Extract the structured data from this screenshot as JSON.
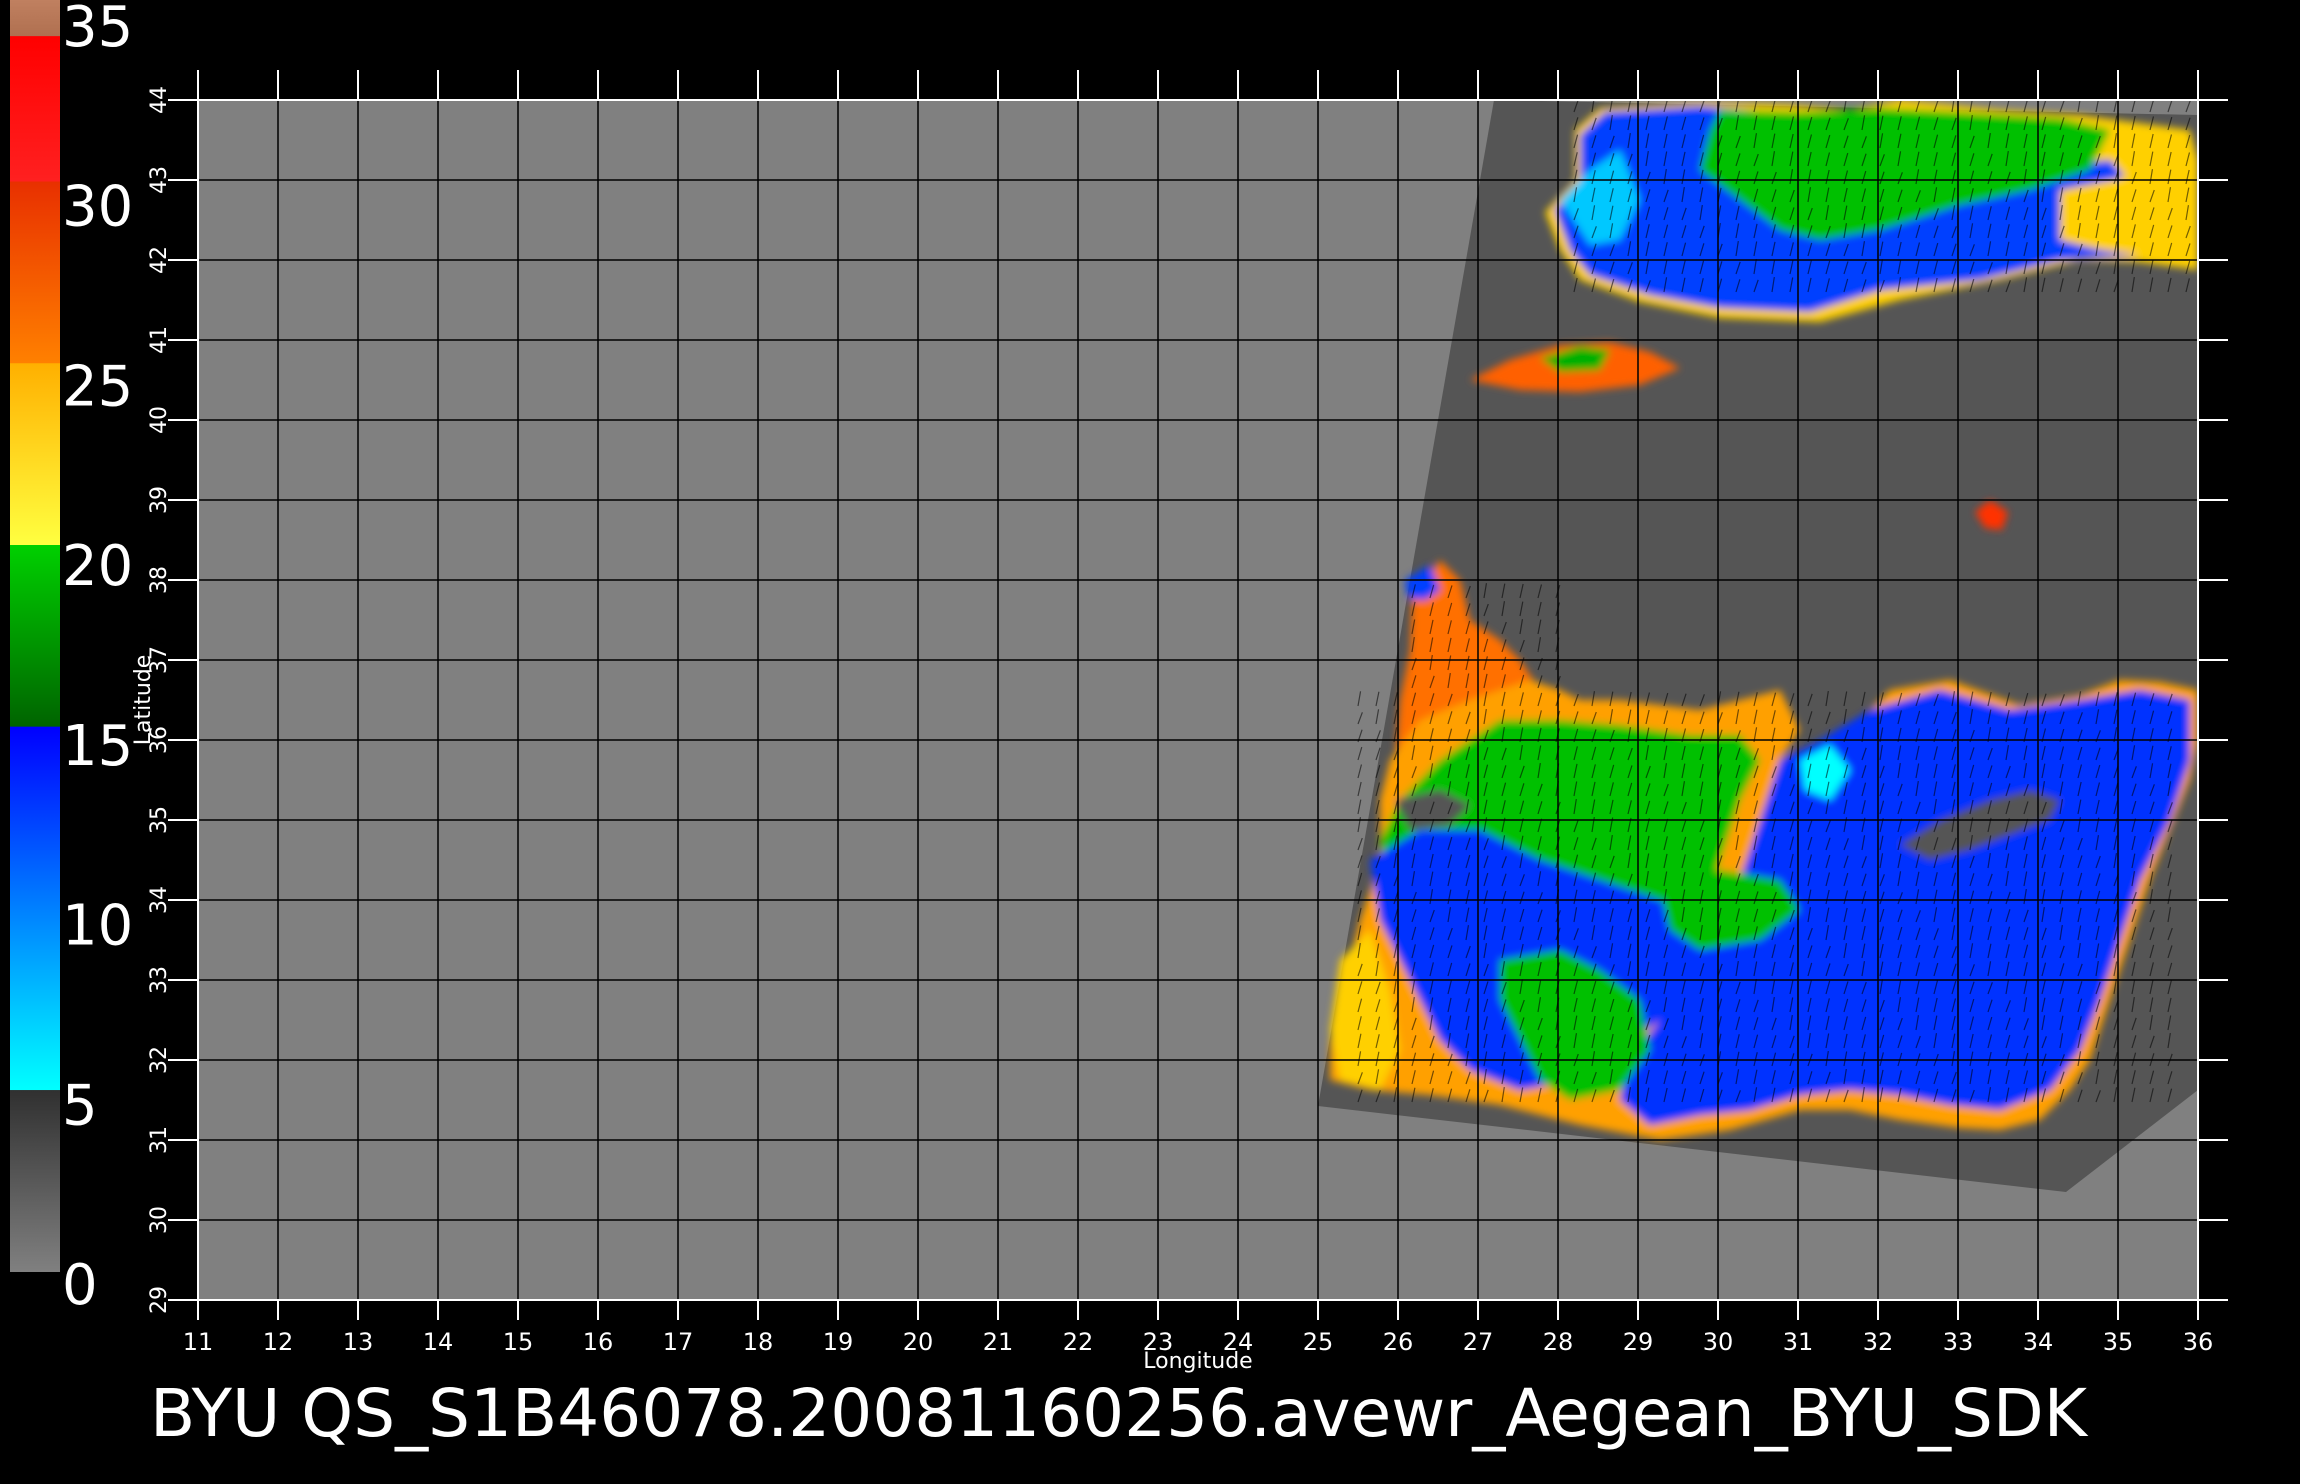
{
  "colorbar": {
    "labels": [
      "35",
      "30",
      "25",
      "20",
      "15",
      "10",
      "5",
      "0"
    ],
    "stops": [
      {
        "value": 0,
        "color": "#808080"
      },
      {
        "value": 5,
        "color": "#303030"
      },
      {
        "value": 5.01,
        "color": "#00ffff"
      },
      {
        "value": 10,
        "color": "#0080ff"
      },
      {
        "value": 15,
        "color": "#0000ff"
      },
      {
        "value": 15.01,
        "color": "#006400"
      },
      {
        "value": 20,
        "color": "#00d000"
      },
      {
        "value": 20.01,
        "color": "#ffff40"
      },
      {
        "value": 25,
        "color": "#ffb000"
      },
      {
        "value": 25.01,
        "color": "#ff8000"
      },
      {
        "value": 30,
        "color": "#e83000"
      },
      {
        "value": 30.01,
        "color": "#ff2020"
      },
      {
        "value": 34,
        "color": "#ff0000"
      },
      {
        "value": 34.01,
        "color": "#b07050"
      },
      {
        "value": 35,
        "color": "#c08060"
      }
    ],
    "range": [
      0,
      35
    ]
  },
  "map": {
    "lon_range": [
      11,
      36
    ],
    "lat_range": [
      29,
      44
    ],
    "lon_ticks": [
      "11",
      "12",
      "13",
      "14",
      "15",
      "16",
      "17",
      "18",
      "19",
      "20",
      "21",
      "22",
      "23",
      "24",
      "25",
      "26",
      "27",
      "28",
      "29",
      "30",
      "31",
      "32",
      "33",
      "34",
      "35",
      "36"
    ],
    "lat_ticks": [
      "29",
      "30",
      "31",
      "32",
      "33",
      "34",
      "35",
      "36",
      "37",
      "38",
      "39",
      "40",
      "41",
      "42",
      "43",
      "44"
    ],
    "xlabel": "Longitude",
    "ylabel": "Latitude",
    "background_color": "#808080",
    "swath_color": "#555555",
    "grid_color": "#000000"
  },
  "caption": "BYU  QS_S1B46078.20081160256.avewr_Aegean_BYU_SDK"
}
